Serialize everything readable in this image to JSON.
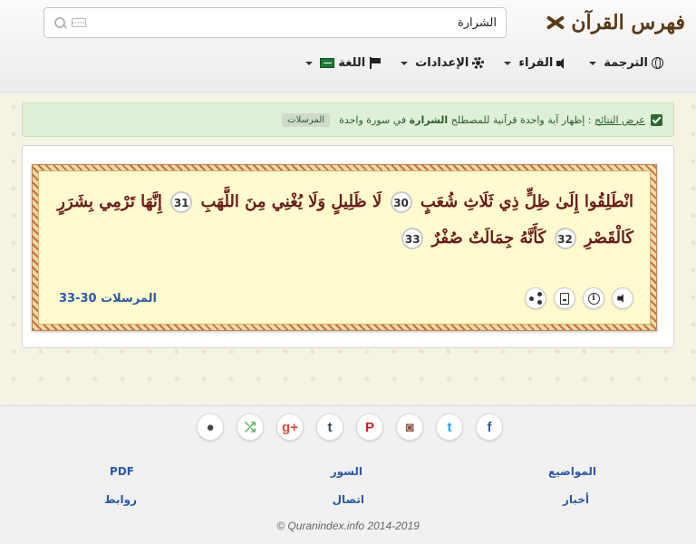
{
  "header": {
    "logo_text": "فهرس القرآن",
    "search": {
      "value": "الشرارة",
      "placeholder": ""
    },
    "nav": [
      {
        "label": "الترجمة",
        "icon": "globe-icon"
      },
      {
        "label": "القراء",
        "icon": "speaker-icon"
      },
      {
        "label": "الإعدادات",
        "icon": "gear-icon"
      },
      {
        "label": "اللغة",
        "icon": "flag-icon"
      }
    ]
  },
  "alert": {
    "link_text": "عرض النتائج",
    "text_before": " : إظهار آية واحدة قرآنية للمصطلح ",
    "term": "الشرارة",
    "text_after": " في سورة واحدة",
    "badge": "المرسلات"
  },
  "verse": {
    "segments": [
      {
        "text": "انْطَلِقُوا إِلَىٰ ظِلٍّ ذِي ثَلَاثِ شُعَبٍ",
        "num": "30"
      },
      {
        "text": "لَا ظَلِيلٍ وَلَا يُغْنِي مِنَ اللَّهَبِ",
        "num": "31"
      },
      {
        "text": "إِنَّهَا تَرْمِي بِشَرَرٍ كَالْقَصْرِ",
        "num": "32"
      },
      {
        "text": "كَأَنَّهُ جِمَالَتٌ صُفْرٌ",
        "num": "33"
      }
    ],
    "reference": "المرسلات 30-33"
  },
  "footer": {
    "social": [
      {
        "name": "facebook",
        "glyph": "f",
        "color": "#3b5998"
      },
      {
        "name": "twitter",
        "glyph": "t",
        "color": "#1da1f2"
      },
      {
        "name": "instagram",
        "glyph": "◙",
        "color": "#8a5a44"
      },
      {
        "name": "pinterest",
        "glyph": "P",
        "color": "#cb2027"
      },
      {
        "name": "tumblr",
        "glyph": "t",
        "color": "#35465c"
      },
      {
        "name": "google-plus",
        "glyph": "g+",
        "color": "#dd4b39"
      },
      {
        "name": "share",
        "glyph": "⤮",
        "color": "#4caf50"
      },
      {
        "name": "github",
        "glyph": "●",
        "color": "#444444"
      }
    ],
    "links": {
      "topics": "المواضيع",
      "surahs": "السور",
      "pdf": "PDF",
      "news": "أخبار",
      "contact": "اتصال",
      "links": "روابط"
    },
    "copyright": "© Quranindex.info 2014-2019"
  }
}
